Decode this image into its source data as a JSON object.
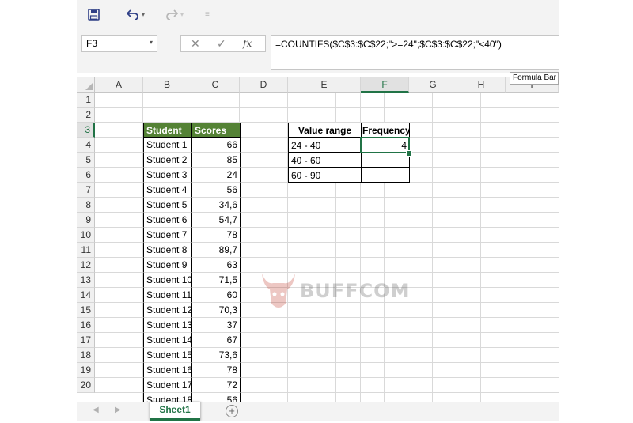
{
  "toolbar": {
    "save_icon": "save-icon",
    "undo_icon": "undo-icon",
    "redo_icon": "redo-icon",
    "caret": "▾"
  },
  "formula_bar": {
    "name_box": "F3",
    "cancel": "✕",
    "enter": "✓",
    "fx": "fx",
    "formula": "=COUNTIFS($C$3:$C$22;\">=24\";$C$3:$C$22;\"<40\")",
    "tooltip": "Formula Bar"
  },
  "columns": [
    "A",
    "B",
    "C",
    "D",
    "E",
    "F",
    "G",
    "H",
    "I"
  ],
  "selected_column": "F",
  "selected_row": "3",
  "rows": [
    "1",
    "2",
    "3",
    "4",
    "5",
    "6",
    "7",
    "8",
    "9",
    "10",
    "11",
    "12",
    "13",
    "14",
    "15",
    "16",
    "17",
    "18",
    "19",
    "20"
  ],
  "table1": {
    "header": {
      "student": "Student",
      "scores": "Scores"
    },
    "students": [
      "Student 1",
      "Student 2",
      "Student 3",
      "Student 4",
      "Student 5",
      "Student 6",
      "Student 7",
      "Student 8",
      "Student 9",
      "Student 10",
      "Student 11",
      "Student 12",
      "Student 13",
      "Student 14",
      "Student 15",
      "Student 16",
      "Student 17",
      "Student 18"
    ],
    "scores": [
      "66",
      "85",
      "24",
      "56",
      "34,6",
      "54,7",
      "78",
      "89,7",
      "63",
      "71,5",
      "60",
      "70,3",
      "37",
      "67",
      "73,6",
      "78",
      "72",
      "56"
    ]
  },
  "table2": {
    "header": {
      "range": "Value range",
      "frequency": "Frequency"
    },
    "ranges": [
      "24 - 40",
      "40 - 60",
      "60 - 90"
    ],
    "frequencies": [
      "4",
      "",
      ""
    ]
  },
  "watermark": {
    "text": "BUFFCOM"
  },
  "sheets": {
    "active": "Sheet1",
    "add": "+"
  },
  "colors": {
    "accent": "#217346",
    "header_fill": "#548235"
  }
}
